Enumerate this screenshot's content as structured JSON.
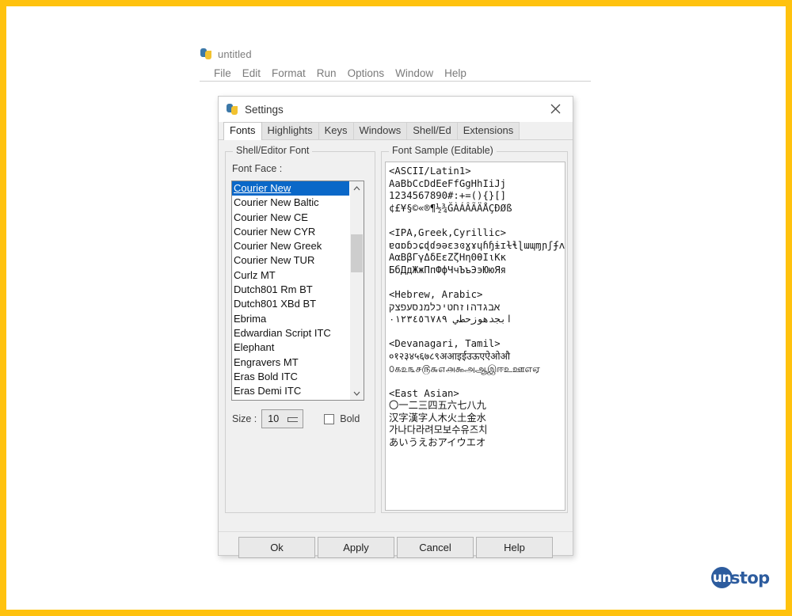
{
  "frame": {
    "border_color": "#FFC20E"
  },
  "idle_window": {
    "title": "untitled",
    "icon": "python-file-icon",
    "menu": [
      "File",
      "Edit",
      "Format",
      "Run",
      "Options",
      "Window",
      "Help"
    ]
  },
  "settings_dialog": {
    "title": "Settings",
    "icon": "python-file-icon",
    "close_label": "✕",
    "tabs": [
      {
        "label": "Fonts",
        "active": true
      },
      {
        "label": "Highlights",
        "active": false
      },
      {
        "label": "Keys",
        "active": false
      },
      {
        "label": "Windows",
        "active": false
      },
      {
        "label": "Shell/Ed",
        "active": false
      },
      {
        "label": "Extensions",
        "active": false
      }
    ],
    "shell_editor_font": {
      "group_label": "Shell/Editor Font",
      "font_face_label": "Font Face :",
      "selected_font": "Courier New",
      "fonts": [
        "Courier New",
        "Courier New Baltic",
        "Courier New CE",
        "Courier New CYR",
        "Courier New Greek",
        "Courier New TUR",
        "Curlz MT",
        "Dutch801 Rm BT",
        "Dutch801 XBd BT",
        "Ebrima",
        "Edwardian Script ITC",
        "Elephant",
        "Engravers MT",
        "Eras Bold ITC",
        "Eras Demi ITC"
      ],
      "size_label": "Size :",
      "size_value": "10",
      "bold_label": "Bold",
      "bold_checked": false,
      "scrollbar": {
        "up_icon": "chevron-up-icon",
        "down_icon": "chevron-down-icon"
      }
    },
    "font_sample": {
      "group_label": "Font Sample (Editable)",
      "text": "<ASCII/Latin1>\nAaBbCcDdEeFfGgHhIiJj\n1234567890#:+=(){}[]\n¢£¥§©«®¶½¾ĞÀÁÂÃÄÅÇÐØß\n\n<IPA,Greek,Cyrillic>\nɐɑɒɓɔɕɖɗɘəɛɜɞɣɤɥɦɧɨɪɫɬɭɯɰɱɲʃʄʌʍʎʒʔʕ\nΑαΒβΓγΔδΕεΖζΗηΘθΙιΚκ\nБбДдЖжПпФфЧчЪъЭэЮюЯя\n\n<Hebrew, Arabic>\nאבגדהוזחטיכלמנסעפצק\nابجدهوزحطي ٠١٢٣٤٥٦٧٨٩\n\n<Devanagari, Tamil>\n०१२३४५६७८९अआइईउऊएऐओऔ\n௦௧௨௩௪௫௬௭௮௯அஆஇஈஉஊஎஏ\n\n<East Asian>\n〇一二三四五六七八九\n汉字漢字人木火土金水\n가나다라려모보수유즈치\nあいうえおアイウエオ"
    },
    "buttons": [
      {
        "label": "Ok"
      },
      {
        "label": "Apply"
      },
      {
        "label": "Cancel"
      },
      {
        "label": "Help"
      }
    ]
  },
  "watermark": {
    "badge_text": "un",
    "word_text": "stop",
    "color": "#2D5C9E"
  }
}
